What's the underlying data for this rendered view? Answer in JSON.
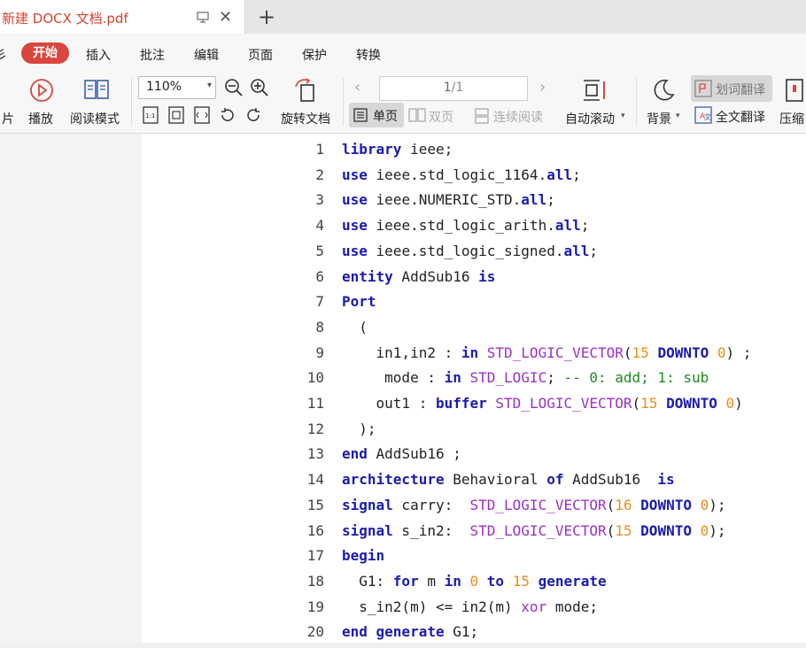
{
  "tab": {
    "title": "新建 DOCX 文档.pdf",
    "close": "✕",
    "new": "+"
  },
  "menu": {
    "partial_left": "彡",
    "items": [
      "开始",
      "插入",
      "批注",
      "编辑",
      "页面",
      "保护",
      "转换"
    ]
  },
  "toolbar": {
    "partial_left": "片",
    "play": "播放",
    "read_mode": "阅读模式",
    "zoom": "110%",
    "rotate": "旋转文档",
    "page_current": "1",
    "page_total": "/1",
    "single": "单页",
    "double": "双页",
    "continuous": "连续阅读",
    "auto_scroll": "自动滚动",
    "background": "背景",
    "word_translate": "划词翻译",
    "full_translate": "全文翻译",
    "compress": "压缩"
  },
  "code": {
    "lines": [
      {
        "n": "1",
        "t": [
          [
            "kw",
            "library"
          ],
          [
            "id",
            " ieee;"
          ]
        ]
      },
      {
        "n": "2",
        "t": [
          [
            "kw",
            "use"
          ],
          [
            "id",
            " ieee.std_logic_1164."
          ],
          [
            "kw",
            "all"
          ],
          [
            "id",
            ";"
          ]
        ]
      },
      {
        "n": "3",
        "t": [
          [
            "kw",
            "use"
          ],
          [
            "id",
            " ieee.NUMERIC_STD."
          ],
          [
            "kw",
            "all"
          ],
          [
            "id",
            ";"
          ]
        ]
      },
      {
        "n": "4",
        "t": [
          [
            "kw",
            "use"
          ],
          [
            "id",
            " ieee.std_logic_arith."
          ],
          [
            "kw",
            "all"
          ],
          [
            "id",
            ";"
          ]
        ]
      },
      {
        "n": "5",
        "t": [
          [
            "kw",
            "use"
          ],
          [
            "id",
            " ieee.std_logic_signed."
          ],
          [
            "kw",
            "all"
          ],
          [
            "id",
            ";"
          ]
        ]
      },
      {
        "n": "6",
        "t": [
          [
            "kw",
            "entity"
          ],
          [
            "id",
            " AddSub16 "
          ],
          [
            "kw",
            "is"
          ]
        ]
      },
      {
        "n": "7",
        "t": [
          [
            "kw",
            "Port"
          ]
        ]
      },
      {
        "n": "8",
        "t": [
          [
            "id",
            "  ("
          ]
        ]
      },
      {
        "n": "9",
        "t": [
          [
            "id",
            "    in1,in2 : "
          ],
          [
            "kw",
            "in"
          ],
          [
            "id",
            " "
          ],
          [
            "ty",
            "STD_LOGIC_VECTOR"
          ],
          [
            "id",
            "("
          ],
          [
            "num",
            "15"
          ],
          [
            "id",
            " "
          ],
          [
            "kw",
            "DOWNTO"
          ],
          [
            "id",
            " "
          ],
          [
            "num",
            "0"
          ],
          [
            "id",
            ") ;"
          ]
        ]
      },
      {
        "n": "10",
        "t": [
          [
            "id",
            "     mode : "
          ],
          [
            "kw",
            "in"
          ],
          [
            "id",
            " "
          ],
          [
            "ty",
            "STD_LOGIC"
          ],
          [
            "id",
            "; "
          ],
          [
            "cm",
            "-- 0: add; 1: sub"
          ]
        ]
      },
      {
        "n": "11",
        "t": [
          [
            "id",
            "    out1 : "
          ],
          [
            "kw",
            "buffer"
          ],
          [
            "id",
            " "
          ],
          [
            "ty",
            "STD_LOGIC_VECTOR"
          ],
          [
            "id",
            "("
          ],
          [
            "num",
            "15"
          ],
          [
            "id",
            " "
          ],
          [
            "kw",
            "DOWNTO"
          ],
          [
            "id",
            " "
          ],
          [
            "num",
            "0"
          ],
          [
            "id",
            ")"
          ]
        ]
      },
      {
        "n": "12",
        "t": [
          [
            "id",
            "  );"
          ]
        ]
      },
      {
        "n": "13",
        "t": [
          [
            "kw",
            "end"
          ],
          [
            "id",
            " AddSub16 ;"
          ]
        ]
      },
      {
        "n": "14",
        "t": [
          [
            "kw",
            "architecture"
          ],
          [
            "id",
            " Behavioral "
          ],
          [
            "kw",
            "of"
          ],
          [
            "id",
            " AddSub16  "
          ],
          [
            "kw",
            "is"
          ]
        ]
      },
      {
        "n": "15",
        "t": [
          [
            "kw",
            "signal"
          ],
          [
            "id",
            " carry:  "
          ],
          [
            "ty",
            "STD_LOGIC_VECTOR"
          ],
          [
            "id",
            "("
          ],
          [
            "num",
            "16"
          ],
          [
            "id",
            " "
          ],
          [
            "kw",
            "DOWNTO"
          ],
          [
            "id",
            " "
          ],
          [
            "num",
            "0"
          ],
          [
            "id",
            ");"
          ]
        ]
      },
      {
        "n": "16",
        "t": [
          [
            "kw",
            "signal"
          ],
          [
            "id",
            " s_in2:  "
          ],
          [
            "ty",
            "STD_LOGIC_VECTOR"
          ],
          [
            "id",
            "("
          ],
          [
            "num",
            "15"
          ],
          [
            "id",
            " "
          ],
          [
            "kw",
            "DOWNTO"
          ],
          [
            "id",
            " "
          ],
          [
            "num",
            "0"
          ],
          [
            "id",
            ");"
          ]
        ]
      },
      {
        "n": "17",
        "t": [
          [
            "kw",
            "begin"
          ]
        ]
      },
      {
        "n": "18",
        "t": [
          [
            "id",
            "  G1: "
          ],
          [
            "kw",
            "for"
          ],
          [
            "id",
            " m "
          ],
          [
            "kw",
            "in"
          ],
          [
            "id",
            " "
          ],
          [
            "num",
            "0"
          ],
          [
            "id",
            " "
          ],
          [
            "kw",
            "to"
          ],
          [
            "id",
            " "
          ],
          [
            "num",
            "15"
          ],
          [
            "id",
            " "
          ],
          [
            "kw",
            "generate"
          ]
        ]
      },
      {
        "n": "19",
        "t": [
          [
            "id",
            "  s_in2(m) <= in2(m) "
          ],
          [
            "ty",
            "xor"
          ],
          [
            "id",
            " mode;"
          ]
        ]
      },
      {
        "n": "20",
        "t": [
          [
            "kw",
            "end generate"
          ],
          [
            "id",
            " G1;"
          ]
        ]
      }
    ]
  },
  "colors": {
    "accent": "#d9463d",
    "keyword": "#1a1ab5",
    "type": "#9b30c8",
    "number": "#f08a1a",
    "comment": "#1f8a1f"
  }
}
